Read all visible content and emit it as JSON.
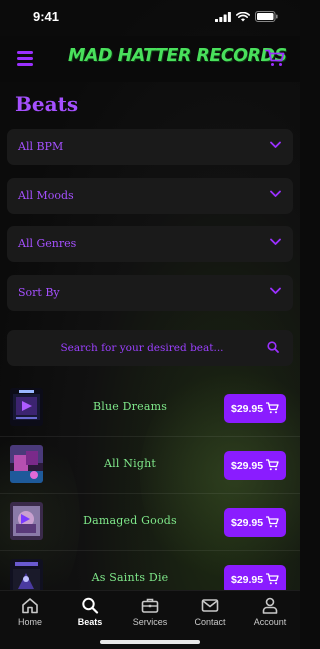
{
  "status_bar": {
    "time": "9:41"
  },
  "header": {
    "logo_text": "MAD HATTER RECORDS",
    "menu_icon": "hamburger-menu-icon",
    "cart_icon": "shopping-cart-icon"
  },
  "page": {
    "title": "Beats"
  },
  "filters": [
    {
      "label": "All BPM"
    },
    {
      "label": "All Moods"
    },
    {
      "label": "All Genres"
    },
    {
      "label": "Sort By"
    }
  ],
  "search": {
    "placeholder": "Search for your desired beat...",
    "icon": "search-icon"
  },
  "beats": [
    {
      "title": "Blue Dreams",
      "price": "$29.95"
    },
    {
      "title": "All Night",
      "price": "$29.95"
    },
    {
      "title": "Damaged Goods",
      "price": "$29.95"
    },
    {
      "title": "As Saints Die",
      "price": "$29.95"
    }
  ],
  "tabbar": {
    "items": [
      {
        "label": "Home",
        "icon": "home-icon",
        "active": false
      },
      {
        "label": "Beats",
        "icon": "search-icon",
        "active": true
      },
      {
        "label": "Services",
        "icon": "briefcase-icon",
        "active": false
      },
      {
        "label": "Contact",
        "icon": "envelope-icon",
        "active": false
      },
      {
        "label": "Account",
        "icon": "user-icon",
        "active": false
      }
    ]
  },
  "colors": {
    "accent_purple": "#8a1cff",
    "title_purple": "#a550ff",
    "logo_green": "#49e05c",
    "beat_title_green": "#7fe88a",
    "background": "#0b0b0b",
    "panel": "#1a1a1a"
  }
}
